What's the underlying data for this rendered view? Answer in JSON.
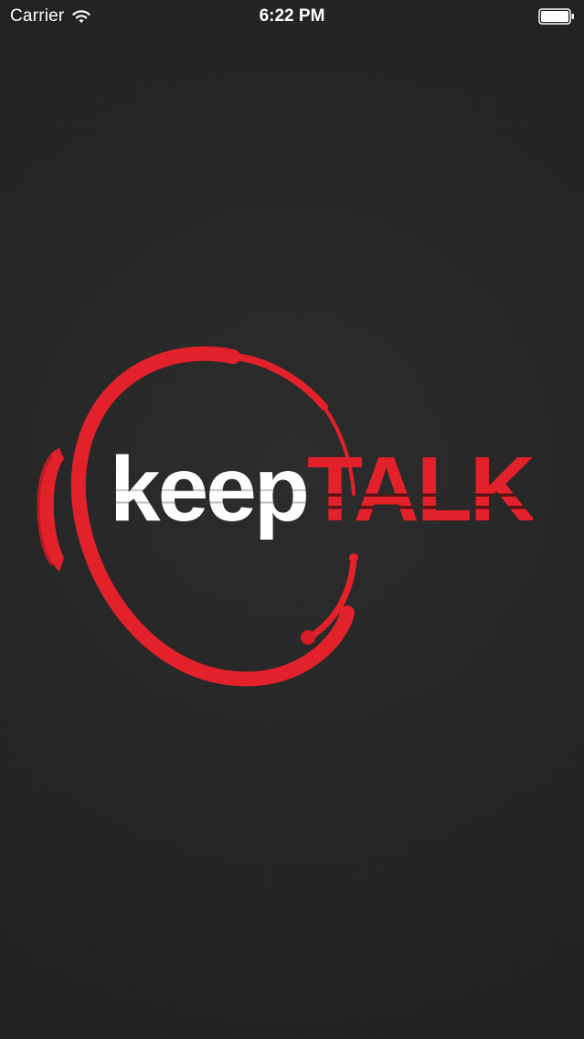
{
  "status_bar": {
    "carrier": "Carrier",
    "time": "6:22 PM",
    "icons": [
      "wifi-icon",
      "battery-icon"
    ]
  },
  "splash": {
    "logo_text_part1": "keep",
    "logo_text_part2": "TALK",
    "logo_icon": "headset-icon"
  },
  "colors": {
    "background": "#252525",
    "brand_red": "#e3212a",
    "text_white": "#ffffff"
  }
}
